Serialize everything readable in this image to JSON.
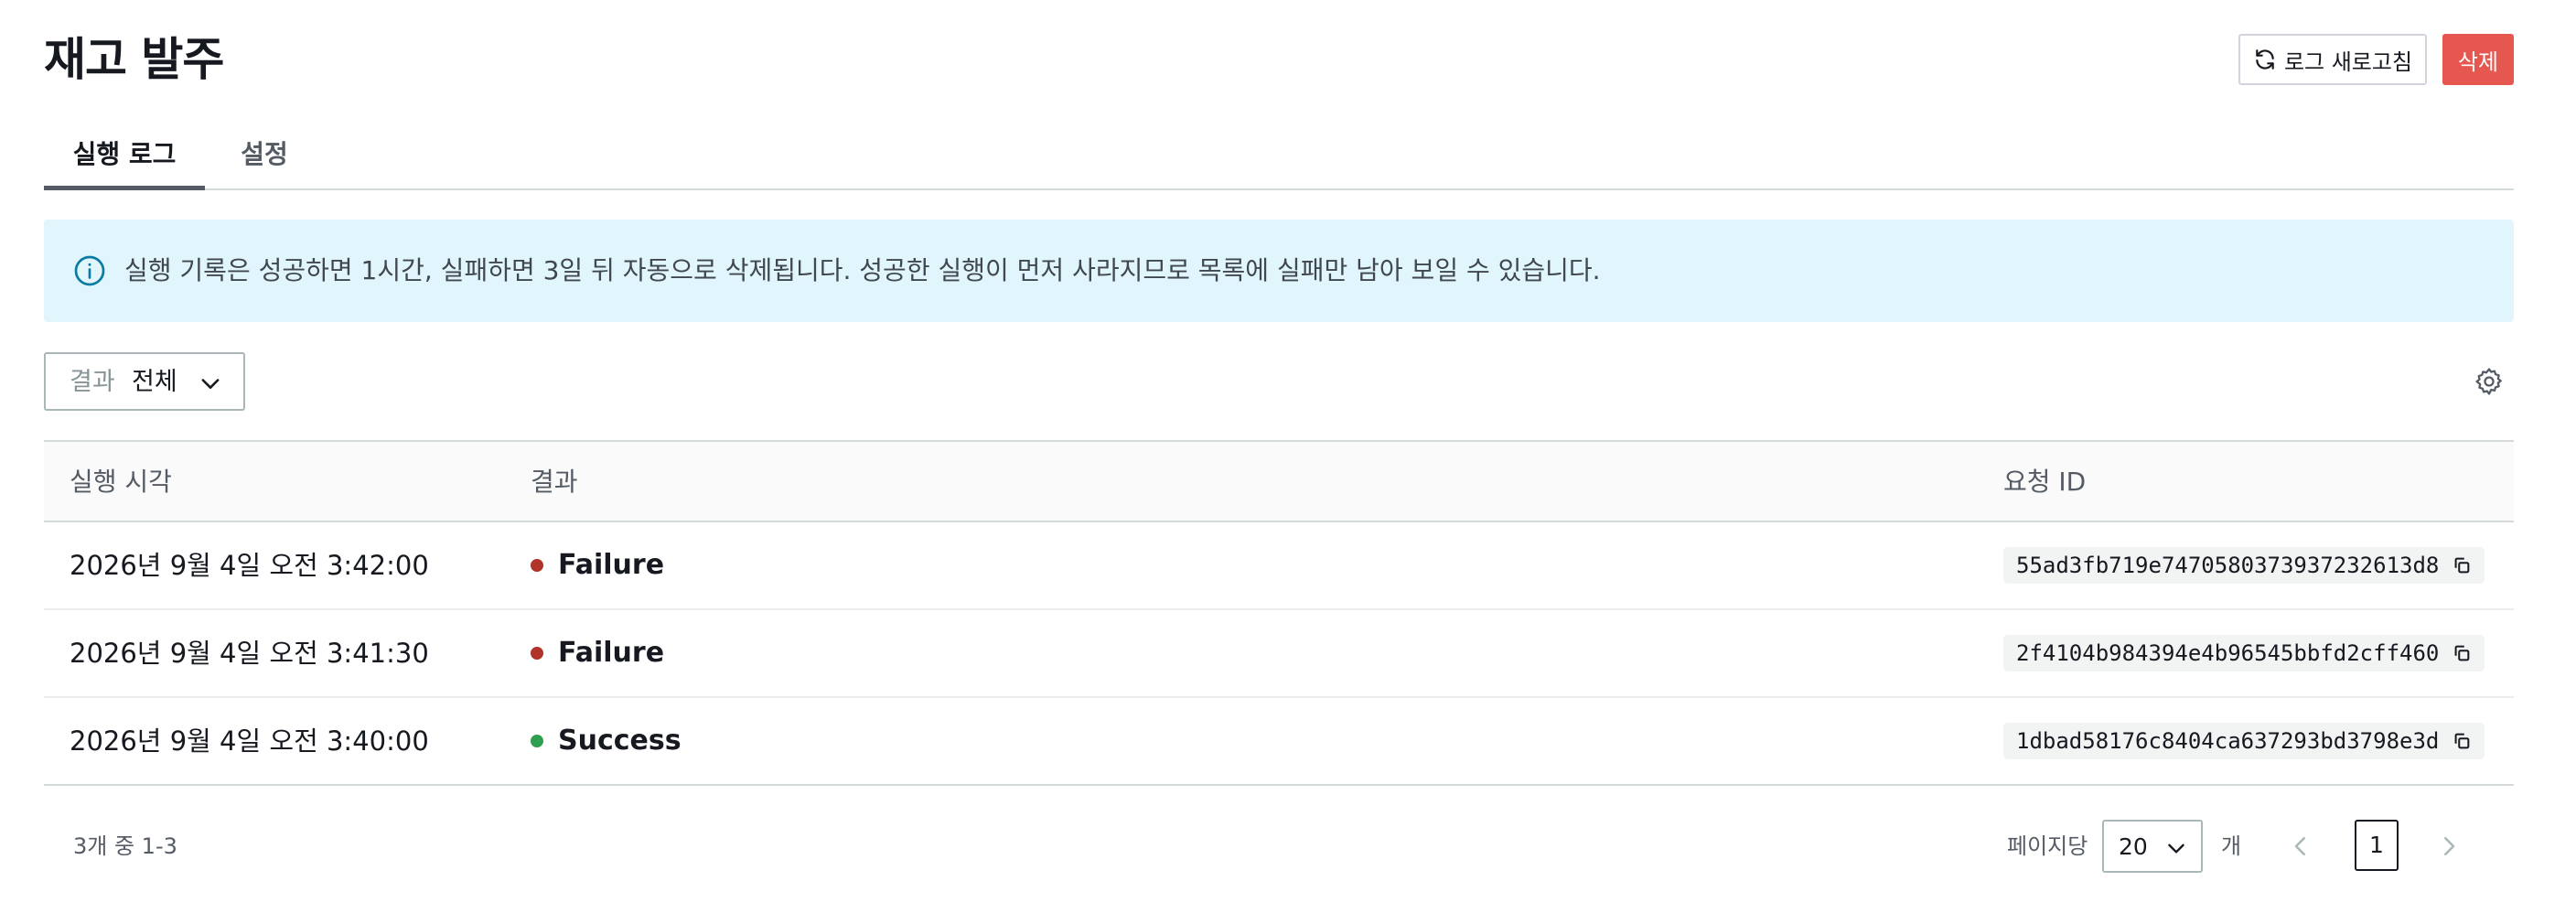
{
  "header": {
    "title": "재고 발주",
    "refresh_label": "로그 새로고침",
    "delete_label": "삭제",
    "delete_color": "#e5574f"
  },
  "tabs": [
    {
      "label": "실행 로그",
      "active": true
    },
    {
      "label": "설정",
      "active": false
    }
  ],
  "info_banner": {
    "icon": "info-icon",
    "text": "실행 기록은 성공하면 1시간, 실패하면 3일 뒤 자동으로 삭제됩니다. 성공한 실행이 먼저 사라지므로 목록에 실패만 남아 보일 수 있습니다."
  },
  "filter": {
    "label": "결과",
    "value": "전체"
  },
  "table": {
    "columns": [
      "실행 시각",
      "결과",
      "요청 ID"
    ],
    "rows": [
      {
        "time": "2026년 9월 4일 오전 3:42:00",
        "result": "Failure",
        "status_color": "#b0342a",
        "request_id": "55ad3fb719e7470580373937232613d8"
      },
      {
        "time": "2026년 9월 4일 오전 3:41:30",
        "result": "Failure",
        "status_color": "#b0342a",
        "request_id": "2f4104b984394e4b96545bbfd2cff460"
      },
      {
        "time": "2026년 9월 4일 오전 3:40:00",
        "result": "Success",
        "status_color": "#2e9e4f",
        "request_id": "1dbad58176c8404ca637293bd3798e3d"
      }
    ]
  },
  "footer": {
    "range_text": "3개 중 1-3",
    "per_page_label": "페이지당",
    "per_page_value": "20",
    "per_page_unit": "개",
    "current_page": "1"
  }
}
